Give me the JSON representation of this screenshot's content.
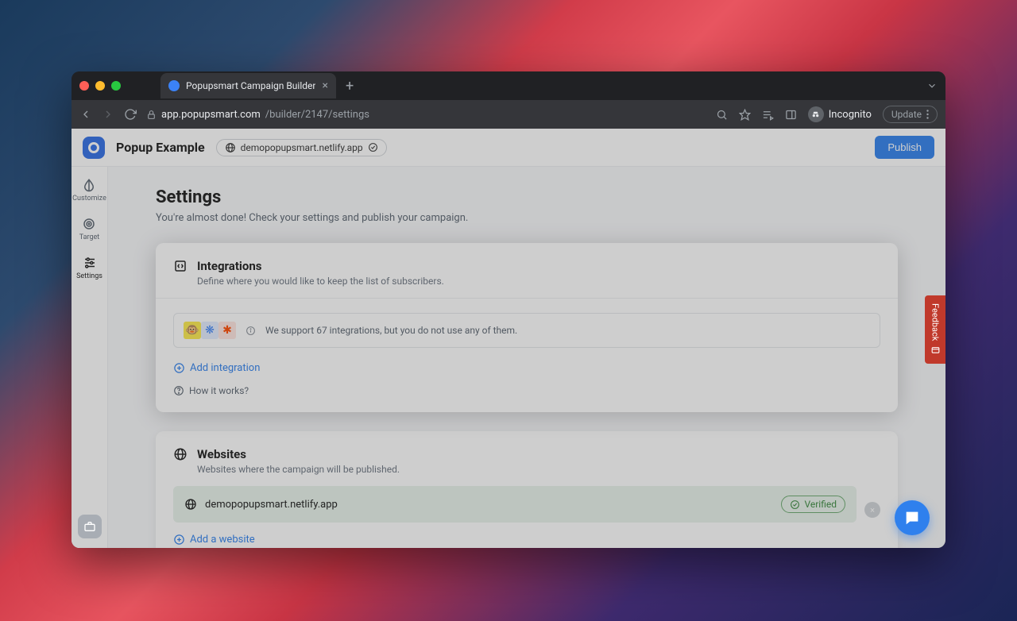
{
  "browser": {
    "tab_title": "Popupsmart Campaign Builder",
    "url_host": "app.popupsmart.com",
    "url_path": "/builder/2147/settings",
    "incognito_label": "Incognito",
    "update_label": "Update"
  },
  "header": {
    "app_title": "Popup Example",
    "domain": "demopopupsmart.netlify.app",
    "publish_label": "Publish"
  },
  "left_nav": {
    "items": [
      {
        "label": "Customize"
      },
      {
        "label": "Target"
      },
      {
        "label": "Settings"
      }
    ]
  },
  "page": {
    "title": "Settings",
    "subtitle": "You're almost done! Check your settings and publish your campaign."
  },
  "integrations": {
    "title": "Integrations",
    "subtitle": "Define where you would like to keep the list of subscribers.",
    "notice_text": "We support 67 integrations, but you do not use any of them.",
    "add_label": "Add integration",
    "how_label": "How it works?"
  },
  "websites": {
    "title": "Websites",
    "subtitle": "Websites where the campaign will be published.",
    "items": [
      {
        "domain": "demopopupsmart.netlify.app",
        "status": "Verified"
      }
    ],
    "add_label": "Add a website"
  },
  "feedback_label": "Feedback"
}
